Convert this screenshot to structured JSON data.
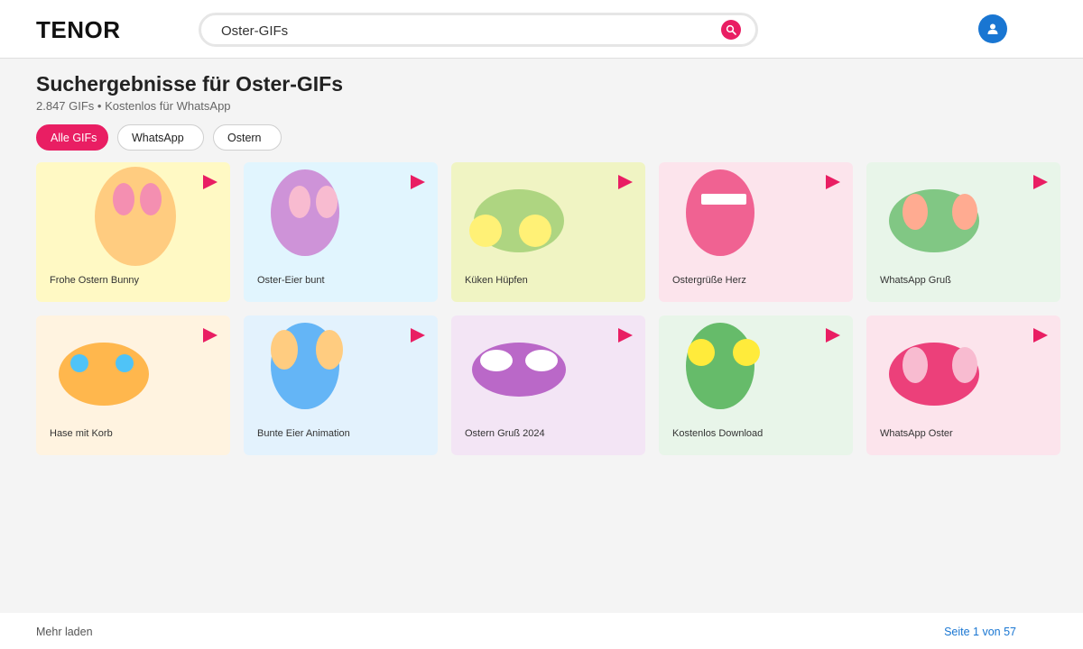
{
  "header": {
    "logo": "TENOR",
    "search": {
      "value": "Oster-GIFs"
    }
  },
  "results": {
    "title": "Suchergebnisse für Oster-GIFs",
    "subtitle": "2.847 GIFs • Kostenlos für WhatsApp"
  },
  "filters": [
    {
      "label": "Alle GIFs",
      "active": true
    },
    {
      "label": "WhatsApp",
      "active": false
    },
    {
      "label": "Ostern",
      "active": false
    }
  ],
  "colors": {
    "accent": "#e91e63",
    "user_blue": "#1976d2"
  },
  "gifs": [
    {
      "title": "Frohe Ostern Bunny",
      "bg": "#fff9c4",
      "body": "#ffcc80",
      "spots": "#f48fb1",
      "shape": "egg-tall",
      "spot_layout": "top"
    },
    {
      "title": "Oster-Eier bunt",
      "bg": "#e1f5fe",
      "body": "#ce93d8",
      "spots": "#f8bbd0",
      "shape": "egg",
      "spot_layout": "top"
    },
    {
      "title": "Küken Hüpfen",
      "bg": "#f0f4c3",
      "body": "#aed581",
      "spots": "#fff176",
      "shape": "oval",
      "spot_layout": "sides"
    },
    {
      "title": "Ostergrüße Herz",
      "bg": "#fce4ec",
      "body": "#f06292",
      "spots": "#ffffff",
      "shape": "egg",
      "spot_layout": "band"
    },
    {
      "title": "WhatsApp Gruß",
      "bg": "#e8f5e9",
      "body": "#81c784",
      "spots": "#ffab91",
      "shape": "oval",
      "spot_layout": "ears"
    },
    {
      "title": "Hase mit Korb",
      "bg": "#fff3e0",
      "body": "#ffb74d",
      "spots": "#4fc3f7",
      "shape": "oval",
      "spot_layout": "top-small"
    },
    {
      "title": "Bunte Eier Animation",
      "bg": "#e3f2fd",
      "body": "#64b5f6",
      "spots": "#ffcc80",
      "shape": "egg",
      "spot_layout": "sides-tall"
    },
    {
      "title": "Ostern Gruß 2024",
      "bg": "#f3e5f5",
      "body": "#ba68c8",
      "spots": "#ffffff",
      "shape": "wide",
      "spot_layout": "top-wide"
    },
    {
      "title": "Kostenlos Download",
      "bg": "#e8f5e9",
      "body": "#66bb6a",
      "spots": "#ffeb3b",
      "shape": "egg",
      "spot_layout": "top-sides"
    },
    {
      "title": "WhatsApp Oster",
      "bg": "#fce4ec",
      "body": "#ec407a",
      "spots": "#f8bbd0",
      "shape": "oval",
      "spot_layout": "ears"
    }
  ],
  "footer": {
    "load_more": "Mehr laden",
    "pagination": "Seite 1 von 57"
  }
}
